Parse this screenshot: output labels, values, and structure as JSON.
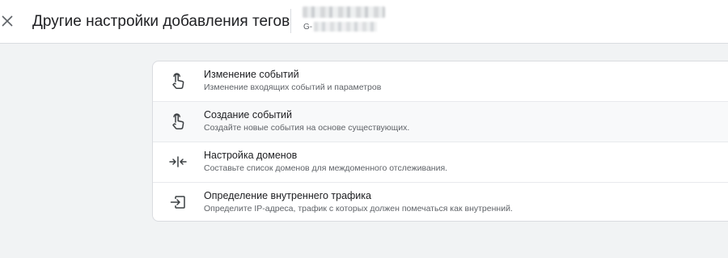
{
  "header": {
    "close_icon": "close-icon",
    "title": "Другие настройки добавления тегов",
    "stream_id_prefix": "G-"
  },
  "settings": {
    "items": [
      {
        "icon": "touch-icon",
        "label": "Изменение событий",
        "description": "Изменение входящих событий и параметров"
      },
      {
        "icon": "touch-icon",
        "label": "Создание событий",
        "description": "Создайте новые события на основе существующих."
      },
      {
        "icon": "merge-arrows-icon",
        "label": "Настройка доменов",
        "description": "Составьте список доменов для междоменного отслеживания."
      },
      {
        "icon": "login-arrow-icon",
        "label": "Определение внутреннего трафика",
        "description": "Определите IP-адреса, трафик с которых должен помечаться как внутренний."
      }
    ]
  },
  "colors": {
    "background": "#f1f3f4",
    "card": "#ffffff",
    "text_primary": "#202124",
    "text_secondary": "#5f6368",
    "divider": "#dadce0"
  }
}
